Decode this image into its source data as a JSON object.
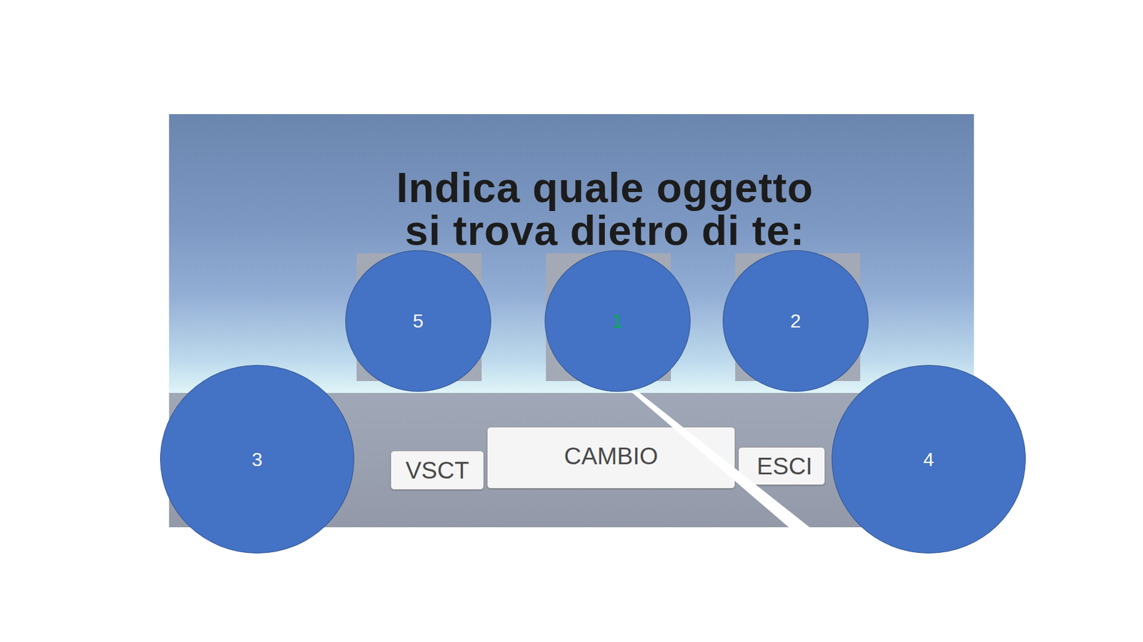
{
  "slide": {
    "screenshot": {
      "prompt": [
        "Indica quale oggetto",
        "si trova dietro di te:"
      ],
      "buttons": [
        {
          "label": "VSCT"
        },
        {
          "label": "CAMBIO"
        },
        {
          "label": "ESCI"
        }
      ]
    },
    "markers": [
      {
        "label": "5",
        "color": "#ffffff"
      },
      {
        "label": "1",
        "color": "#00b050"
      },
      {
        "label": "2",
        "color": "#ffffff"
      },
      {
        "label": "3",
        "color": "#ffffff"
      },
      {
        "label": "4",
        "color": "#ffffff"
      }
    ]
  }
}
